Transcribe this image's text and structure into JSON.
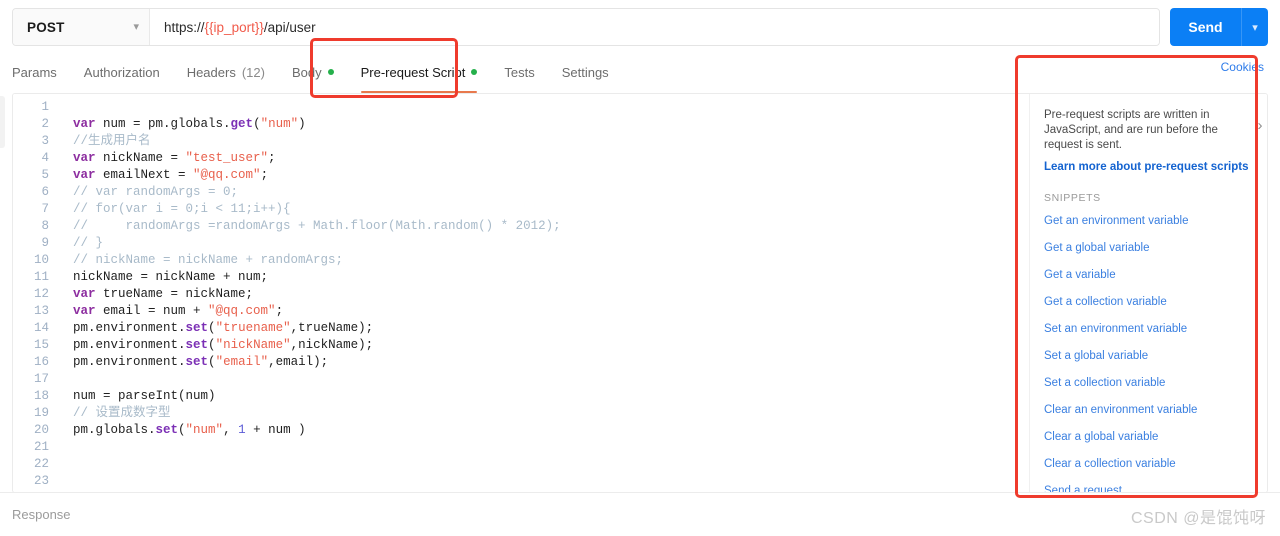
{
  "request": {
    "method": "POST",
    "method_caret": "chevron-down",
    "url_prefix": "https://",
    "url_variable": "{{ip_port}}",
    "url_suffix": "/api/user",
    "url_full": "https://{{ip_port}}/api/user",
    "send_label": "Send",
    "send_caret": "chevron-down"
  },
  "tabs": [
    {
      "label": "Params",
      "active": false,
      "dot": false,
      "count": ""
    },
    {
      "label": "Authorization",
      "active": false,
      "dot": false,
      "count": ""
    },
    {
      "label": "Headers",
      "active": false,
      "dot": false,
      "count": "(12)"
    },
    {
      "label": "Body",
      "active": false,
      "dot": true,
      "count": ""
    },
    {
      "label": "Pre-request Script",
      "active": true,
      "dot": true,
      "count": ""
    },
    {
      "label": "Tests",
      "active": false,
      "dot": false,
      "count": ""
    },
    {
      "label": "Settings",
      "active": false,
      "dot": false,
      "count": ""
    }
  ],
  "cookies_link": "Cookies",
  "editor": {
    "total_lines": 23,
    "lines": [
      {
        "n": 1,
        "tokens": []
      },
      {
        "n": 2,
        "tokens": [
          {
            "t": "kw",
            "v": "var"
          },
          {
            "t": "pun",
            "v": " num = pm.globals."
          },
          {
            "t": "fn",
            "v": "get"
          },
          {
            "t": "pun",
            "v": "("
          },
          {
            "t": "str",
            "v": "\"num\""
          },
          {
            "t": "pun",
            "v": ")"
          }
        ]
      },
      {
        "n": 3,
        "tokens": [
          {
            "t": "cmt",
            "v": "//生成用户名"
          }
        ]
      },
      {
        "n": 4,
        "tokens": [
          {
            "t": "kw",
            "v": "var"
          },
          {
            "t": "pun",
            "v": " nickName = "
          },
          {
            "t": "str",
            "v": "\"test_user\""
          },
          {
            "t": "pun",
            "v": ";"
          }
        ]
      },
      {
        "n": 5,
        "tokens": [
          {
            "t": "kw",
            "v": "var"
          },
          {
            "t": "pun",
            "v": " emailNext = "
          },
          {
            "t": "str",
            "v": "\"@qq.com\""
          },
          {
            "t": "pun",
            "v": ";"
          }
        ]
      },
      {
        "n": 6,
        "tokens": [
          {
            "t": "cmt",
            "v": "// var randomArgs = 0;"
          }
        ]
      },
      {
        "n": 7,
        "tokens": [
          {
            "t": "cmt",
            "v": "// for(var i = 0;i < 11;i++){"
          }
        ]
      },
      {
        "n": 8,
        "tokens": [
          {
            "t": "cmt",
            "v": "//     randomArgs =randomArgs + Math.floor(Math.random() * 2012);"
          }
        ]
      },
      {
        "n": 9,
        "tokens": [
          {
            "t": "cmt",
            "v": "// }"
          }
        ]
      },
      {
        "n": 10,
        "tokens": [
          {
            "t": "cmt",
            "v": "// nickName = nickName + randomArgs;"
          }
        ]
      },
      {
        "n": 11,
        "tokens": [
          {
            "t": "pun",
            "v": "nickName = nickName + num;"
          }
        ]
      },
      {
        "n": 12,
        "tokens": [
          {
            "t": "kw",
            "v": "var"
          },
          {
            "t": "pun",
            "v": " trueName = nickName;"
          }
        ]
      },
      {
        "n": 13,
        "tokens": [
          {
            "t": "kw",
            "v": "var"
          },
          {
            "t": "pun",
            "v": " email = num + "
          },
          {
            "t": "str",
            "v": "\"@qq.com\""
          },
          {
            "t": "pun",
            "v": ";"
          }
        ]
      },
      {
        "n": 14,
        "tokens": [
          {
            "t": "pun",
            "v": "pm.environment."
          },
          {
            "t": "fn",
            "v": "set"
          },
          {
            "t": "pun",
            "v": "("
          },
          {
            "t": "str",
            "v": "\"truename\""
          },
          {
            "t": "pun",
            "v": ",trueName);"
          }
        ]
      },
      {
        "n": 15,
        "tokens": [
          {
            "t": "pun",
            "v": "pm.environment."
          },
          {
            "t": "fn",
            "v": "set"
          },
          {
            "t": "pun",
            "v": "("
          },
          {
            "t": "str",
            "v": "\"nickName\""
          },
          {
            "t": "pun",
            "v": ",nickName);"
          }
        ]
      },
      {
        "n": 16,
        "tokens": [
          {
            "t": "pun",
            "v": "pm.environment."
          },
          {
            "t": "fn",
            "v": "set"
          },
          {
            "t": "pun",
            "v": "("
          },
          {
            "t": "str",
            "v": "\"email\""
          },
          {
            "t": "pun",
            "v": ",email);"
          }
        ]
      },
      {
        "n": 17,
        "tokens": []
      },
      {
        "n": 18,
        "tokens": [
          {
            "t": "pun",
            "v": "num = parseInt(num)"
          }
        ]
      },
      {
        "n": 19,
        "tokens": [
          {
            "t": "cmt",
            "v": "// 设置成数字型"
          }
        ]
      },
      {
        "n": 20,
        "tokens": [
          {
            "t": "pun",
            "v": "pm.globals."
          },
          {
            "t": "fn",
            "v": "set"
          },
          {
            "t": "pun",
            "v": "("
          },
          {
            "t": "str",
            "v": "\"num\""
          },
          {
            "t": "pun",
            "v": ", "
          },
          {
            "t": "num",
            "v": "1"
          },
          {
            "t": "pun",
            "v": " + num )"
          }
        ]
      },
      {
        "n": 21,
        "tokens": []
      },
      {
        "n": 22,
        "tokens": []
      },
      {
        "n": 23,
        "tokens": []
      }
    ]
  },
  "docs": {
    "intro": "Pre-request scripts are written in JavaScript, and are run before the request is sent.",
    "learn_more": "Learn more about pre-request scripts",
    "snippets_heading": "SNIPPETS",
    "snippets": [
      "Get an environment variable",
      "Get a global variable",
      "Get a variable",
      "Get a collection variable",
      "Set an environment variable",
      "Set a global variable",
      "Set a collection variable",
      "Clear an environment variable",
      "Clear a global variable",
      "Clear a collection variable",
      "Send a request"
    ],
    "collapse_icon": "chevron-right"
  },
  "footer": {
    "response_label": "Response",
    "watermark": "CSDN @是馄饨呀"
  },
  "colors": {
    "accent_blue": "#0b7ff5",
    "link_blue": "#3a7fe0",
    "tab_underline": "#e8794d",
    "status_dot_green": "#25b04b",
    "annotation_red": "#ef3b2d",
    "variable_red": "#f15b4b"
  }
}
